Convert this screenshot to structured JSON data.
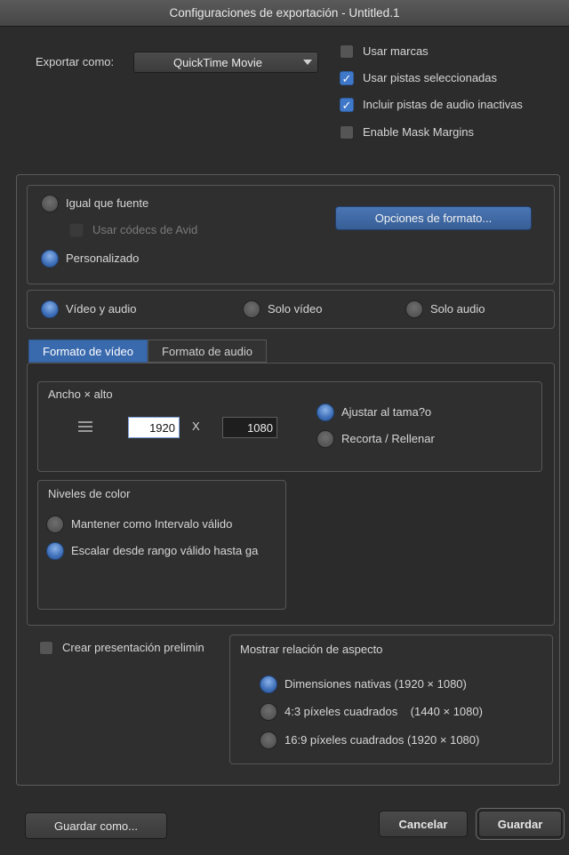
{
  "window": {
    "title": "Configuraciones de exportación - Untitled.1"
  },
  "export": {
    "label": "Exportar como:",
    "selected": "QuickTime Movie",
    "options": [
      {
        "label": "Usar marcas",
        "checked": false
      },
      {
        "label": "Usar pistas seleccionadas",
        "checked": true
      },
      {
        "label": "Incluir pistas de audio inactivas",
        "checked": true
      },
      {
        "label": "Enable Mask Margins",
        "checked": false
      }
    ]
  },
  "source": {
    "same_as_source": "Igual que fuente",
    "use_avid_codecs": "Usar códecs de Avid",
    "custom": "Personalizado",
    "format_options_button": "Opciones de formato..."
  },
  "tracks": {
    "video_audio": "Vídeo y audio",
    "video_only": "Solo vídeo",
    "audio_only": "Solo audio"
  },
  "tabs": {
    "video_format": "Formato de vídeo",
    "audio_format": "Formato de audio"
  },
  "size": {
    "title": "Ancho × alto",
    "width": "1920",
    "separator": "X",
    "height": "1080",
    "fit_to_size": "Ajustar al tama?o",
    "crop_fill": "Recorta / Rellenar"
  },
  "color_levels": {
    "title": "Niveles de color",
    "keep_legal": "Mantener como Intervalo válido",
    "scale_legal": "Escalar desde rango válido hasta ga"
  },
  "preview": {
    "create_label": "Crear presentación prelimin"
  },
  "aspect": {
    "title": "Mostrar relación de aspecto",
    "native": "Dimensiones nativas (1920 × 1080)",
    "four_three": "4:3 píxeles cuadrados    (1440 × 1080)",
    "sixteen_nine": "16:9 píxeles cuadrados (1920 × 1080)"
  },
  "footer": {
    "save_as": "Guardar como...",
    "cancel": "Cancelar",
    "save": "Guardar"
  },
  "colors": {
    "accent": "#3f78c9",
    "background": "#2c2c2c"
  }
}
